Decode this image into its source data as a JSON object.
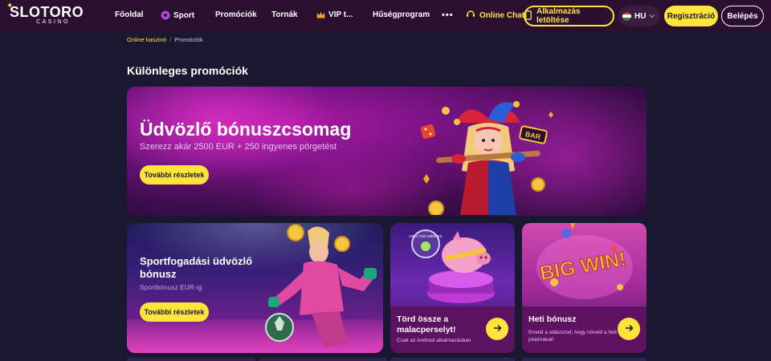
{
  "header": {
    "logo_text": "SLOTORO",
    "logo_sub": "CASINO",
    "nav": [
      {
        "label": "Főoldal",
        "icon": ""
      },
      {
        "label": "Sport",
        "icon": "soccer-ball-icon"
      },
      {
        "label": "Promóciók",
        "icon": ""
      },
      {
        "label": "Tornák",
        "icon": ""
      },
      {
        "label": "VIP t...",
        "icon": "crown-icon"
      },
      {
        "label": "Hűségprogram",
        "icon": ""
      }
    ],
    "more_label": "•••",
    "chat_label": "Online Chat",
    "app_button_label": "Alkalmazás letöltése",
    "lang_label": "HU",
    "register_label": "Regisztráció",
    "login_label": "Belépés",
    "accent_color": "#fde43a"
  },
  "breadcrumb": {
    "home": "Online kaszinó",
    "separator": "/",
    "current": "Promóciók"
  },
  "page_title": "Különleges promóciók",
  "hero": {
    "title": "Üdvözlő bónuszcsomag",
    "subtitle": "Szerezz akár 2500 EUR + 250 ingyenes pörgetést",
    "button_label": "További részletek"
  },
  "cards": {
    "sport": {
      "title": "Sportfogadási üdvözlő bónusz",
      "subtitle": "Sportbónusz          EUR-ig",
      "button_label": "További részletek"
    },
    "piggy": {
      "title": "Törd össze a malacperselyt!",
      "subtitle": "Csak az Android alkalmazásban",
      "badge": "ONLY FOR ANDROID"
    },
    "weekly": {
      "title": "Heti bónusz",
      "subtitle": "Emeld a státuszod, hogy növeld a heti jutalmakat!",
      "art_text": "BIG WIN!"
    }
  }
}
